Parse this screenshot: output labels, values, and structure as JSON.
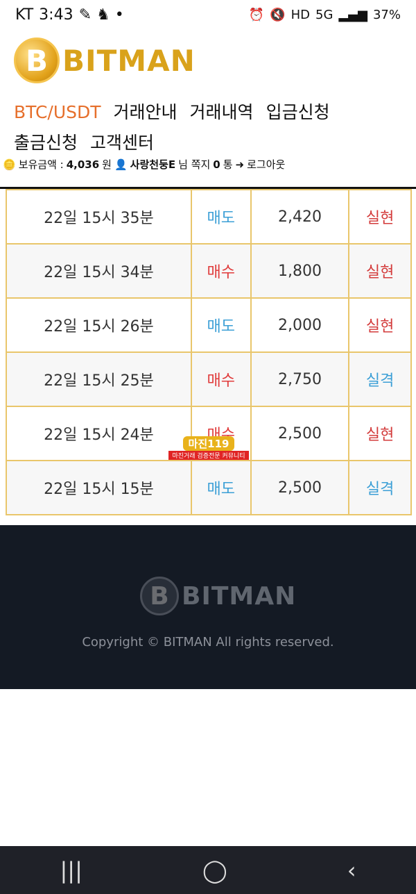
{
  "status": {
    "carrier": "KT",
    "time": "3:43",
    "hd": "HD",
    "network": "5G",
    "battery": "37%"
  },
  "brand": {
    "name": "BITMAN",
    "coin_letter": "B"
  },
  "nav": {
    "items": [
      "BTC/USDT",
      "거래안내",
      "거래내역",
      "입금신청",
      "출금신청",
      "고객센터"
    ]
  },
  "user_bar": {
    "balance_label": "보유금액 :",
    "balance": "4,036",
    "currency": "원",
    "username": "사랑천둥E",
    "honorific": "님 쪽지",
    "messages": "0",
    "message_unit": "통",
    "logout": "로그아웃"
  },
  "trades": [
    {
      "time": "22일 15시 35분",
      "type": "매도",
      "amount": "2,420",
      "result": "실현"
    },
    {
      "time": "22일 15시 34분",
      "type": "매수",
      "amount": "1,800",
      "result": "실현"
    },
    {
      "time": "22일 15시 26분",
      "type": "매도",
      "amount": "2,000",
      "result": "실현"
    },
    {
      "time": "22일 15시 25분",
      "type": "매수",
      "amount": "2,750",
      "result": "실격"
    },
    {
      "time": "22일 15시 24분",
      "type": "매수",
      "amount": "2,500",
      "result": "실현"
    },
    {
      "time": "22일 15시 15분",
      "type": "매도",
      "amount": "2,500",
      "result": "실격"
    }
  ],
  "watermark": {
    "top": "마진119",
    "bottom": "마진거래 검증전문 커뮤니티"
  },
  "footer": {
    "brand": "BITMAN",
    "copyright": "Copyright © BITMAN All rights reserved."
  },
  "colors": {
    "accent": "#e66f2b",
    "gold": "#d9a21b",
    "buy": "#e03b3b",
    "sell": "#3b9fd6"
  }
}
